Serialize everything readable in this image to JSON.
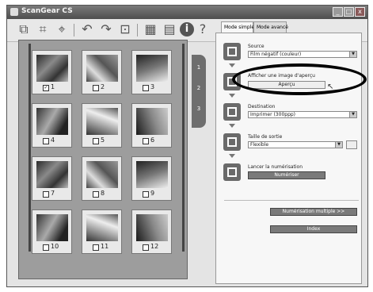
{
  "window": {
    "title": "ScanGear CS",
    "min": "_",
    "max": "□",
    "close": "x"
  },
  "tabs": {
    "simple": "Mode simple",
    "advanced": "Mode avancé"
  },
  "toolbar": {
    "info": "i",
    "help": "?"
  },
  "preview_tabs": [
    "1",
    "2",
    "3"
  ],
  "frames": [
    {
      "n": "1",
      "checked": true
    },
    {
      "n": "2",
      "checked": false
    },
    {
      "n": "3",
      "checked": false
    },
    {
      "n": "4",
      "checked": false
    },
    {
      "n": "5",
      "checked": false
    },
    {
      "n": "6",
      "checked": false
    },
    {
      "n": "7",
      "checked": false
    },
    {
      "n": "8",
      "checked": false
    },
    {
      "n": "9",
      "checked": false
    },
    {
      "n": "10",
      "checked": false
    },
    {
      "n": "11",
      "checked": false
    },
    {
      "n": "12",
      "checked": false
    }
  ],
  "panel": {
    "source_label": "Source",
    "source_value": "Film négatif (couleur)",
    "preview_label": "Afficher une image d'aperçu",
    "preview_button": "Aperçu",
    "destination_label": "Destination",
    "destination_value": "Imprimer (300ppp)",
    "output_label": "Taille de sortie",
    "output_value": "Flexible",
    "scan_label": "Lancer la numérisation",
    "scan_button": "Numériser",
    "multi_button": "Numérisation multiple >>",
    "index_button": "Index"
  }
}
